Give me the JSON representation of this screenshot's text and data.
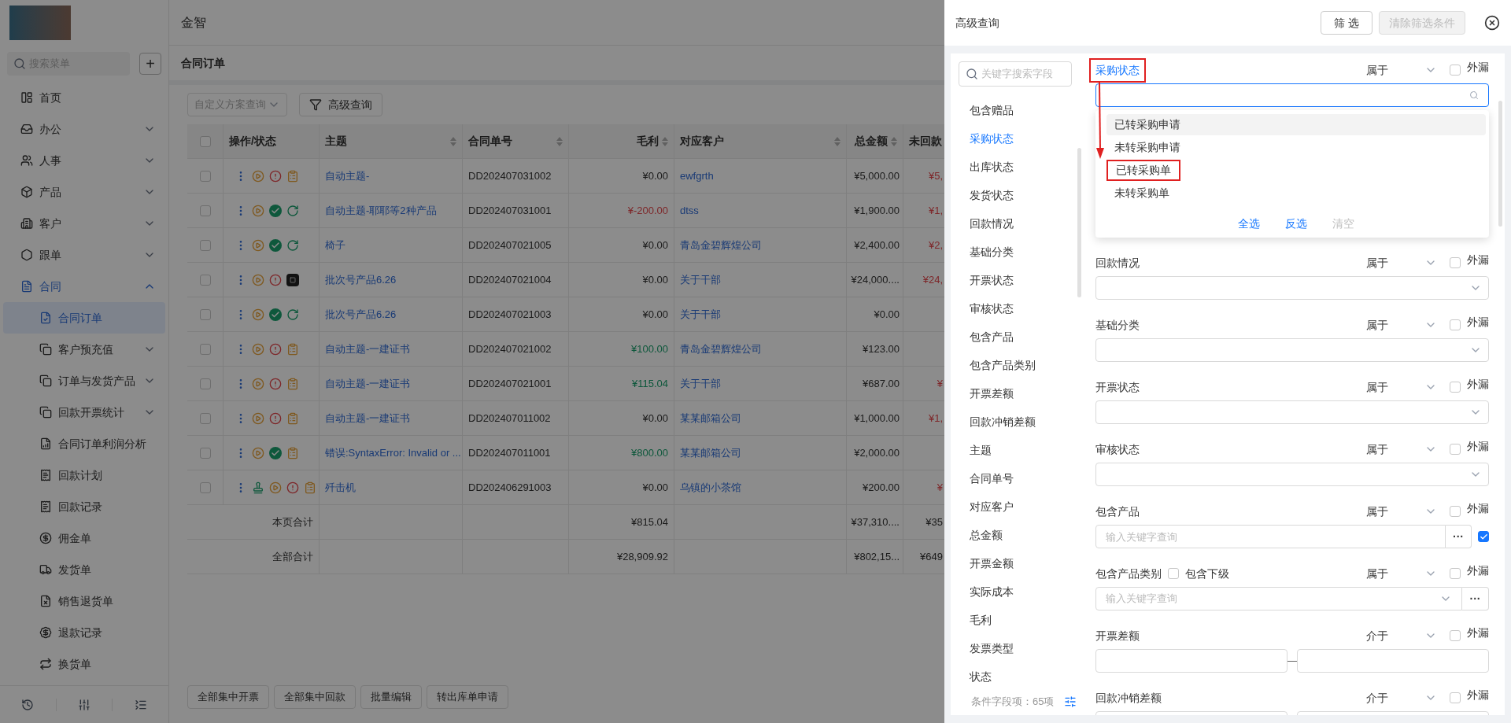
{
  "app_title": "金智",
  "sidebar": {
    "search_placeholder": "搜索菜单",
    "add_label": "+",
    "items": [
      {
        "label": "首页",
        "selected": false
      },
      {
        "label": "办公",
        "selected": false,
        "expanded": false
      },
      {
        "label": "人事",
        "selected": false,
        "expanded": false
      },
      {
        "label": "产品",
        "selected": false,
        "expanded": false
      },
      {
        "label": "客户",
        "selected": false,
        "expanded": false
      },
      {
        "label": "跟单",
        "selected": false,
        "expanded": false
      },
      {
        "label": "合同",
        "selected": false,
        "expanded": true,
        "children": [
          {
            "label": "合同订单",
            "selected": true
          },
          {
            "label": "客户预充值",
            "selected": false,
            "expanded": false
          },
          {
            "label": "订单与发货产品",
            "selected": false,
            "expanded": false
          },
          {
            "label": "回款开票统计",
            "selected": false,
            "expanded": false
          },
          {
            "label": "合同订单利润分析",
            "selected": false
          },
          {
            "label": "回款计划",
            "selected": false
          },
          {
            "label": "回款记录",
            "selected": false
          },
          {
            "label": "佣金单",
            "selected": false
          },
          {
            "label": "发货单",
            "selected": false
          },
          {
            "label": "销售退货单",
            "selected": false
          },
          {
            "label": "退款记录",
            "selected": false
          },
          {
            "label": "换货单",
            "selected": false
          }
        ]
      }
    ]
  },
  "page_title": "合同订单",
  "select_all_checked": false,
  "toolbar": {
    "scheme_placeholder": "自定义方案查询",
    "advanced_query": "高级查询"
  },
  "table": {
    "columns": [
      {
        "label": "操作/状态",
        "sortable": false
      },
      {
        "label": "主题",
        "sortable": true
      },
      {
        "label": "合同单号",
        "sortable": true
      },
      {
        "label": "毛利",
        "sortable": true
      },
      {
        "label": "对应客户",
        "sortable": true
      },
      {
        "label": "总金额",
        "sortable": true
      },
      {
        "label": "未回款",
        "sortable": false
      }
    ],
    "rows": [
      {
        "checked": false,
        "status_icons": [
          {
            "kind": "menu"
          },
          {
            "kind": "play"
          },
          {
            "kind": "alert"
          },
          {
            "kind": "note"
          }
        ],
        "subject": "自动主题-",
        "order_no": "DD202407031002",
        "profit": {
          "text": "¥0.00",
          "kind": "neutral"
        },
        "customer": "ewfgrth",
        "total": "¥5,000.00",
        "unpaid": "¥5,"
      },
      {
        "checked": false,
        "status_icons": [
          {
            "kind": "menu"
          },
          {
            "kind": "play"
          },
          {
            "kind": "check"
          },
          {
            "kind": "flow"
          }
        ],
        "subject": "自动主题-耶耶等2种产品",
        "order_no": "DD202407031001",
        "profit": {
          "text": "¥-200.00",
          "kind": "negative"
        },
        "customer": "dtss",
        "total": "¥1,900.00",
        "unpaid": "¥1,"
      },
      {
        "checked": false,
        "status_icons": [
          {
            "kind": "menu"
          },
          {
            "kind": "play"
          },
          {
            "kind": "check"
          },
          {
            "kind": "flow"
          }
        ],
        "subject": "椅子",
        "order_no": "DD202407021005",
        "profit": {
          "text": "¥0.00",
          "kind": "neutral"
        },
        "customer": "青岛金碧辉煌公司",
        "total": "¥2,400.00",
        "unpaid": "¥2,"
      },
      {
        "checked": false,
        "status_icons": [
          {
            "kind": "menu"
          },
          {
            "kind": "play"
          },
          {
            "kind": "alert"
          },
          {
            "kind": "dark"
          }
        ],
        "subject": "批次号产品6.26",
        "order_no": "DD202407021004",
        "profit": {
          "text": "¥0.00",
          "kind": "neutral"
        },
        "customer": "关于干部",
        "total": "¥24,000....",
        "unpaid": "¥24,"
      },
      {
        "checked": false,
        "status_icons": [
          {
            "kind": "menu"
          },
          {
            "kind": "play"
          },
          {
            "kind": "check"
          },
          {
            "kind": "flow"
          }
        ],
        "subject": "批次号产品6.26",
        "order_no": "DD202407021003",
        "profit": {
          "text": "¥0.00",
          "kind": "neutral"
        },
        "customer": "关于干部",
        "total": "¥0.00"
      },
      {
        "checked": false,
        "status_icons": [
          {
            "kind": "menu"
          },
          {
            "kind": "play"
          },
          {
            "kind": "alert"
          },
          {
            "kind": "note"
          }
        ],
        "subject": "自动主题-一建证书",
        "order_no": "DD202407021002",
        "profit": {
          "text": "¥100.00",
          "kind": "positive"
        },
        "customer": "青岛金碧辉煌公司",
        "total": "¥123.00"
      },
      {
        "checked": false,
        "status_icons": [
          {
            "kind": "menu"
          },
          {
            "kind": "play"
          },
          {
            "kind": "alert"
          },
          {
            "kind": "note"
          }
        ],
        "subject": "自动主题-一建证书",
        "order_no": "DD202407021001",
        "profit": {
          "text": "¥115.04",
          "kind": "positive"
        },
        "customer": "关于干部",
        "total": "¥687.00",
        "unpaid": "¥"
      },
      {
        "checked": false,
        "status_icons": [
          {
            "kind": "menu"
          },
          {
            "kind": "play"
          },
          {
            "kind": "alert"
          },
          {
            "kind": "note"
          }
        ],
        "subject": "自动主题-一建证书",
        "order_no": "DD202407011002",
        "profit": {
          "text": "¥0.00",
          "kind": "neutral"
        },
        "customer": "某某邮箱公司",
        "total": "¥1,000.00",
        "unpaid": "¥1,"
      },
      {
        "checked": false,
        "status_icons": [
          {
            "kind": "menu"
          },
          {
            "kind": "play"
          },
          {
            "kind": "check"
          },
          {
            "kind": "note"
          }
        ],
        "subject": "错误:SyntaxError: Invalid or ...",
        "order_no": "DD202407011001",
        "profit": {
          "text": "¥800.00",
          "kind": "positive"
        },
        "customer": "某某邮箱公司",
        "total": "¥2,000.00"
      },
      {
        "checked": false,
        "status_icons": [
          {
            "kind": "menu"
          },
          {
            "kind": "stamp"
          },
          {
            "kind": "play"
          },
          {
            "kind": "alert"
          },
          {
            "kind": "note"
          }
        ],
        "subject": "歼击机",
        "order_no": "DD202406291003",
        "profit": {
          "text": "¥0.00",
          "kind": "neutral"
        },
        "customer": "乌镇的小茶馆",
        "total": "¥200.00",
        "unpaid": "¥"
      }
    ],
    "totals": [
      {
        "label": "本页合计",
        "profit": "¥815.04",
        "total": "¥37,310....",
        "unpaid": "¥35"
      },
      {
        "label": "全部合计",
        "profit": "¥28,909.92",
        "total": "¥802,15...",
        "unpaid": "¥649"
      }
    ]
  },
  "bottom_buttons": [
    "全部集中开票",
    "全部集中回款",
    "批量编辑",
    "转出库单申请"
  ],
  "drawer": {
    "title": "高级查询",
    "filter_button": "筛 选",
    "clear_button": "清除筛选条件",
    "clear_disabled": true,
    "field_search_placeholder": "关键字搜索字段",
    "field_list": [
      {
        "label": "包含赠品",
        "selected": false
      },
      {
        "label": "采购状态",
        "selected": true
      },
      {
        "label": "出库状态",
        "selected": false
      },
      {
        "label": "发货状态",
        "selected": false
      },
      {
        "label": "回款情况",
        "selected": false
      },
      {
        "label": "基础分类",
        "selected": false
      },
      {
        "label": "开票状态",
        "selected": false
      },
      {
        "label": "审核状态",
        "selected": false
      },
      {
        "label": "包含产品",
        "selected": false
      },
      {
        "label": "包含产品类别",
        "selected": false
      },
      {
        "label": "开票差额",
        "selected": false
      },
      {
        "label": "回款冲销差额",
        "selected": false
      },
      {
        "label": "主题",
        "selected": false
      },
      {
        "label": "合同单号",
        "selected": false
      },
      {
        "label": "对应客户",
        "selected": false
      },
      {
        "label": "总金额",
        "selected": false
      },
      {
        "label": "开票金额",
        "selected": false
      },
      {
        "label": "实际成本",
        "selected": false
      },
      {
        "label": "毛利",
        "selected": false
      },
      {
        "label": "发票类型",
        "selected": false
      },
      {
        "label": "状态",
        "selected": false
      }
    ],
    "field_count": "条件字段项：65项",
    "conditions": [
      {
        "kind": "open-select",
        "label": "采购状态",
        "active": true,
        "annotated": true,
        "operator": "属于",
        "leak_label": "外漏",
        "leak_checked": false,
        "options": [
          {
            "label": "已转采购申请",
            "hovered": true,
            "annotated": false
          },
          {
            "label": "未转采购申请",
            "hovered": false,
            "annotated": false
          },
          {
            "label": "已转采购单",
            "hovered": false,
            "annotated": true
          },
          {
            "label": "未转采购单",
            "hovered": false,
            "annotated": false
          }
        ],
        "actions": [
          {
            "label": "全选",
            "disabled": false
          },
          {
            "label": "反选",
            "disabled": false
          },
          {
            "label": "清空",
            "disabled": true
          }
        ]
      },
      {
        "kind": "select",
        "label": "回款情况",
        "active": false,
        "annotated": false,
        "operator": "属于",
        "leak_label": "外漏",
        "leak_checked": false
      },
      {
        "kind": "select",
        "label": "基础分类",
        "active": false,
        "annotated": false,
        "operator": "属于",
        "leak_label": "外漏",
        "leak_checked": false
      },
      {
        "kind": "select",
        "label": "开票状态",
        "active": false,
        "annotated": false,
        "operator": "属于",
        "leak_label": "外漏",
        "leak_checked": false
      },
      {
        "kind": "select",
        "label": "审核状态",
        "active": false,
        "annotated": false,
        "operator": "属于",
        "leak_label": "外漏",
        "leak_checked": false
      },
      {
        "kind": "picker",
        "label": "包含产品",
        "active": false,
        "annotated": false,
        "operator": "属于",
        "leak_label": "外漏",
        "leak_checked": false,
        "placeholder": "输入关键字查询",
        "more_label": "···",
        "side_checked": true
      },
      {
        "kind": "tree-picker",
        "label": "包含产品类别",
        "active": false,
        "annotated": false,
        "operator": "属于",
        "leak_label": "外漏",
        "leak_checked": false,
        "placeholder": "输入关键字查询",
        "more_label": "···",
        "sub_label": "包含下级",
        "sub_checked": false
      },
      {
        "kind": "range",
        "label": "开票差额",
        "active": false,
        "annotated": false,
        "operator": "介于",
        "leak_label": "外漏",
        "leak_checked": false
      },
      {
        "kind": "range",
        "label": "回款冲销差额",
        "active": false,
        "annotated": false,
        "operator": "介于",
        "leak_label": "外漏",
        "leak_checked": false
      }
    ]
  }
}
